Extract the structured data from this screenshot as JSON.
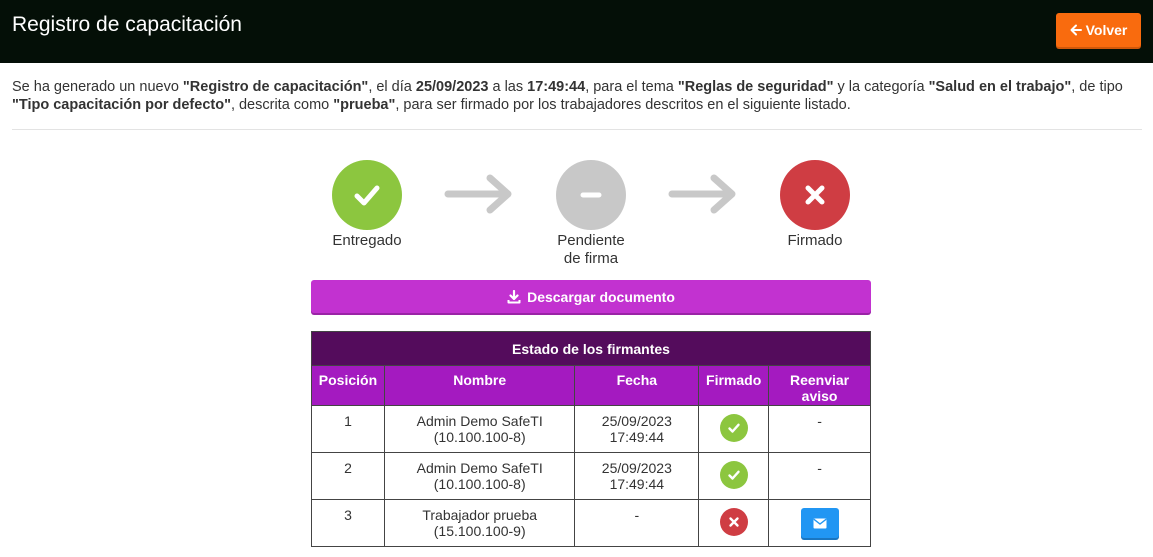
{
  "header": {
    "title": "Registro de capacitación",
    "back_label": "Volver"
  },
  "description": {
    "p1": "Se ha generado un nuevo ",
    "record_name": "\"Registro de capacitación\"",
    "p2": ", el día ",
    "date": "25/09/2023",
    "p3": " a las ",
    "time": "17:49:44",
    "p4": ", para el tema ",
    "topic": "\"Reglas de seguridad\"",
    "p5": " y la categoría ",
    "category": "\"Salud en el trabajo\"",
    "p6": ", de tipo ",
    "type": "\"Tipo capacitación por defecto\"",
    "p7": ", descrita como ",
    "described_as": "\"prueba\"",
    "p8": ", para ser firmado por los trabajadores descritos en el siguiente listado."
  },
  "steps": {
    "delivered": "Entregado",
    "pending_line1": "Pendiente",
    "pending_line2": "de firma",
    "signed": "Firmado"
  },
  "download_label": "Descargar documento",
  "table": {
    "caption": "Estado de los firmantes",
    "headers": {
      "position": "Posición",
      "name": "Nombre",
      "date": "Fecha",
      "signed": "Firmado",
      "resend_line1": "Reenviar",
      "resend_line2": "aviso"
    },
    "rows": [
      {
        "position": "1",
        "name": "Admin Demo SafeTI",
        "rut": "(10.100.100-8)",
        "date": "25/09/2023",
        "time": "17:49:44",
        "signed": true,
        "resend": "-"
      },
      {
        "position": "2",
        "name": "Admin Demo SafeTI",
        "rut": "(10.100.100-8)",
        "date": "25/09/2023",
        "time": "17:49:44",
        "signed": true,
        "resend": "-"
      },
      {
        "position": "3",
        "name": "Trabajador prueba",
        "rut": "(15.100.100-9)",
        "date": "-",
        "time": "",
        "signed": false,
        "resend": "envelope-icon"
      }
    ]
  },
  "colors": {
    "topbar": "#040f07",
    "back_button": "#f96b0e",
    "delivered": "#8cc63f",
    "pending": "#c8c8c8",
    "signed_no": "#cf3d43",
    "download": "#c232d0",
    "table_caption": "#540c5c",
    "table_header": "#a41ac0",
    "resend_button": "#2196f3"
  }
}
